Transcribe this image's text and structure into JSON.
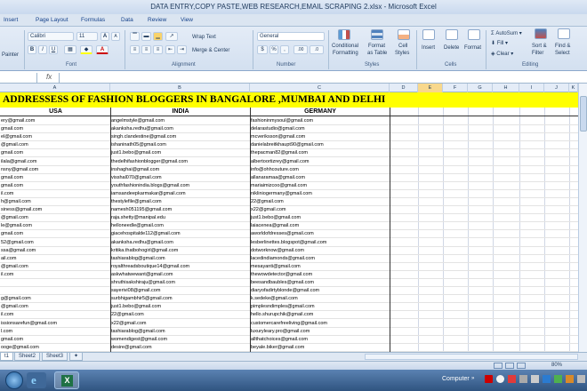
{
  "window": {
    "title": "DATA ENTRY,COPY PASTE,WEB RESEARCH,EMAIL SCRAPING 2.xlsx  -  Microsoft Excel"
  },
  "menu_tabs": [
    "Insert",
    "Page Layout",
    "Formulas",
    "Data",
    "Review",
    "View"
  ],
  "ribbon": {
    "clipboard": {
      "paste_label": "Painter"
    },
    "font": {
      "name": "Calibri",
      "size": "11",
      "group_label": "Font",
      "grow": "A",
      "shrink": "A"
    },
    "alignment": {
      "wrap_text": "Wrap Text",
      "merge_center": "Merge & Center",
      "group_label": "Alignment"
    },
    "number": {
      "format": "General",
      "group_label": "Number",
      "currency": "$",
      "percent": "%",
      "comma": ",",
      "inc_decimal": ".00",
      "dec_decimal": ".0"
    },
    "styles": {
      "conditional": "Conditional",
      "conditional2": "Formatting",
      "format_table": "Format",
      "format_table2": "as Table",
      "cell_styles": "Cell",
      "cell_styles2": "Styles",
      "group_label": "Styles"
    },
    "cells": {
      "insert": "Insert",
      "delete": "Delete",
      "format": "Format",
      "group_label": "Cells"
    },
    "editing": {
      "autosum": "AutoSum",
      "fill": "Fill",
      "clear": "Clear",
      "sort_filter": "Sort &",
      "sort_filter2": "Filter",
      "find_select": "Find &",
      "find_select2": "Select",
      "group_label": "Editing"
    }
  },
  "formula_bar": {
    "fx": "fx"
  },
  "columns": [
    "A",
    "B",
    "C",
    "D",
    "E",
    "F",
    "G",
    "H",
    "I",
    "J",
    "K"
  ],
  "sheet": {
    "title": "ADDRESSESS OF FASHION BLOGGERS IN BANGALORE ,MUMBAI AND DELHI",
    "headers": [
      "USA",
      "INDIA",
      "GERMANY"
    ],
    "rows": [
      [
        "ery@gmail.com",
        "angelmstyle@gmail.com",
        "fashioninmysoul@gmail.com"
      ],
      [
        "gmail.com",
        "akanksha.redhu@gmail.com",
        "delarastudio@gmail.com"
      ],
      [
        "el@gmail.com",
        "singh.clandestine@gmail.com",
        "mcveriksson@gmail.com"
      ],
      [
        "@gmail.com",
        "ishaninath05@gmail.com",
        "danielabreitkhaupt90@gmail.com"
      ],
      [
        "gmail.com",
        "just1.bebo@gmail.com",
        "thepacman82@gmail.com"
      ],
      [
        "ilala@gmail.com",
        "thedelhifashionblogger@gmail.com",
        "albertoortizrey@gmail.com"
      ],
      [
        "nsny@gmail.com",
        "inshaghai@gmail.com",
        "info@ohhcouture.com"
      ],
      [
        "gmail.com",
        "visshal070@gmail.com",
        "allanaramaa@gmail.com"
      ],
      [
        "gmail.com",
        "youthfashionindia.blogs@gmail.com",
        "mariaimizcoo@gmail.com"
      ],
      [
        "il.com",
        "iamsandeepkarmakar@gmail.com",
        "nikliniogermany@gmail.com"
      ],
      [
        "h@gmail.com",
        "thestylefile@gmail.com",
        "22@gmail.com"
      ],
      [
        "siness@gmail.com",
        "namesh051195@gmail.com",
        "x22@gmail.com"
      ],
      [
        "@gmail.com",
        "raja.shetty@manipal.edu",
        "just1.bebo@gmail.com"
      ],
      [
        "le@gmail.com",
        "helloneedle@gmail.com",
        "laiacenea@gmail.com"
      ],
      [
        "gmail.com",
        "giacehospitalde112@gmail.com",
        "aworldofdresses@gmail.com"
      ],
      [
        "52@gmail.com",
        "akanksha.redhu@gmail.com",
        "lesberlinettes.blogspot@gmail.com"
      ],
      [
        "ssa@gmail.com",
        "kritika.thatbohogirl@gmail.com",
        "dotworknow@gmail.com"
      ],
      [
        "ail.com",
        "tashiarablog@gmail.com",
        "lacedindiamonds@gmail.com"
      ],
      [
        "@gmail.com",
        "royalthreadsboutique14@gmail.com",
        "mesayanti@gmail.com"
      ],
      [
        "il.com",
        "askwhatwewant@gmail.com",
        "thewowdetector@gmail.com"
      ],
      [
        "",
        "shruthisakshiraju@gmail.com",
        "beesandbaubles@gmail.com"
      ],
      [
        "",
        "sayerivi08@gmail.com",
        "diaryofadirtyblonde@gmail.com"
      ],
      [
        "g@gmail.com",
        "surbhigambhir5@gmail.com",
        "k.sedeke@gmail.com"
      ],
      [
        "@gmail.com",
        "just1.bebo@gmail.com",
        "pimplesndimples@gmail.com"
      ],
      [
        "il.com",
        "22@gmail.com",
        "hello.shurupchik@gmail.com"
      ],
      [
        "issionsarefun@gmail.com",
        "x22@gmail.com",
        "customercarefreeliving@gmail.com"
      ],
      [
        "l.com",
        "tashiarablog@gmail.com",
        "luxuryleary.pro@gmail.com"
      ],
      [
        "gmail.com",
        "womendigest@gmail.com",
        "allthatchoices@gmail.com"
      ],
      [
        "ooge@gmail.com",
        "desire@gmail.com",
        "beyale.biker@gmail.com"
      ]
    ]
  },
  "sheet_tabs": [
    "t1",
    "Sheet2",
    "Sheet3"
  ],
  "status": {
    "zoom": "80%"
  },
  "taskbar": {
    "computer": "Computer"
  },
  "colors": {
    "title_band": "#ffff00",
    "ribbon": "#dbe5f1",
    "taskbar": "#2f5480"
  }
}
